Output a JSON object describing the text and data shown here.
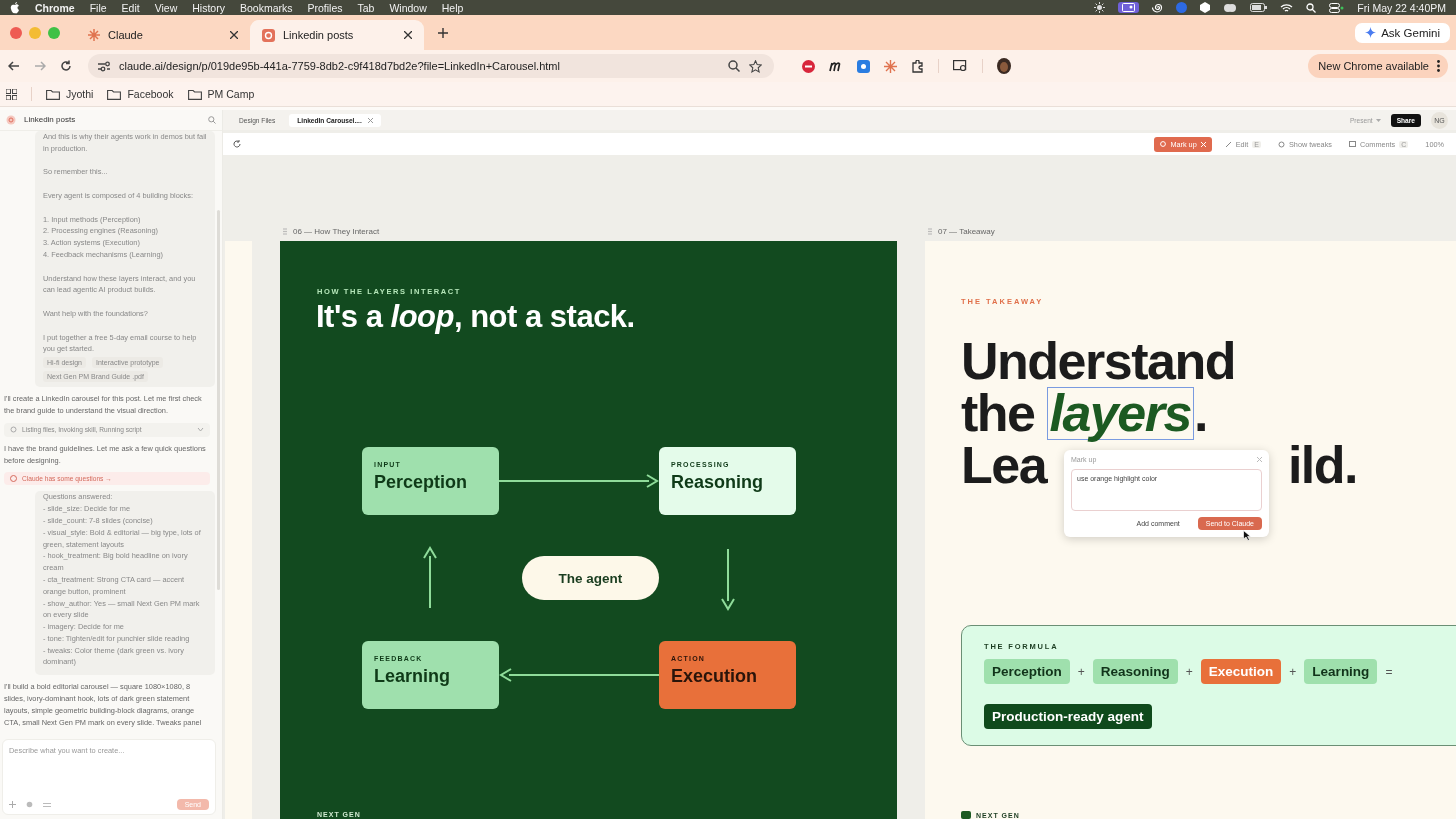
{
  "menubar": {
    "app": "Chrome",
    "menus": [
      "File",
      "Edit",
      "View",
      "History",
      "Bookmarks",
      "Profiles",
      "Tab",
      "Window",
      "Help"
    ],
    "clock": "Fri May 22  4:40PM"
  },
  "tabs": [
    {
      "title": "Claude",
      "selected": false
    },
    {
      "title": "Linkedin posts",
      "selected": true
    }
  ],
  "ask_gemini": "Ask Gemini",
  "address": "claude.ai/design/p/019de95b-441a-7759-8db2-c9f418d7bd2e?file=LinkedIn+Carousel.html",
  "update_button": "New Chrome available",
  "bookmarks": [
    "Jyothi",
    "Facebook",
    "PM Camp"
  ],
  "sidebar": {
    "title": "Linkedin posts",
    "messages": [
      {
        "kind": "user",
        "paragraphs": [
          "And this is why their agents work in demos but fail in production.",
          "So remember this...",
          "Every agent is composed of 4 building blocks:",
          "1. Input methods (Perception)\n2. Processing engines (Reasoning)\n3. Action systems (Execution)\n4. Feedback mechanisms (Learning)",
          "Understand how these layers interact, and you can lead agentic AI product builds.",
          "Want help with the foundations?",
          "I put together a free 5-day email course to help you get started."
        ],
        "attachments": [
          "Hi-fi design",
          "Interactive prototype",
          "Next Gen PM Brand Guide .pdf"
        ]
      },
      {
        "kind": "assistant",
        "text": "I'll create a LinkedIn carousel for this post. Let me first check the brand guide to understand the visual direction."
      },
      {
        "kind": "tool",
        "text": "Listing files, Invoking skill, Running script"
      },
      {
        "kind": "assistant",
        "text": "I have the brand guidelines. Let me ask a few quick questions before designing."
      },
      {
        "kind": "notice",
        "text": "Claude has some questions →"
      },
      {
        "kind": "user",
        "paragraphs": [
          "Questions answered:\n- slide_size: Decide for me\n- slide_count: 7-8 slides (concise)\n- visual_style: Bold & editorial — big type, lots of green, statement layouts\n- hook_treatment: Big bold headline on ivory cream\n- cta_treatment: Strong CTA card — accent orange button, prominent\n- show_author: Yes — small Next Gen PM mark on every slide\n- imagery: Decide for me\n- tone: Tighten/edit for punchier slide reading\n- tweaks: Color theme (dark green vs. ivory dominant)"
        ]
      },
      {
        "kind": "assistant",
        "text": "I'll build a bold editorial carousel — square 1080×1080, 8 slides, ivory-dominant hook, lots of dark green statement layouts, simple geometric building-block diagrams, orange CTA, small Next Gen PM mark on every slide. Tweaks panel"
      }
    ],
    "composer": {
      "placeholder": "Describe what you want to create...",
      "send": "Send"
    }
  },
  "design_tabs": [
    {
      "title": "Design Files",
      "selected": false
    },
    {
      "title": "LinkedIn Carousel....",
      "selected": true
    }
  ],
  "header_actions": {
    "present": "Present",
    "share": "Share",
    "avatar": "NG"
  },
  "toolbar": [
    {
      "kind": "markup",
      "label": "Mark up",
      "selected": true
    },
    {
      "kind": "tool",
      "label": "Edit",
      "shortcut": "E",
      "selected": false
    },
    {
      "kind": "tool",
      "label": "Show tweaks",
      "selected": false
    },
    {
      "kind": "tool",
      "label": "Comments",
      "shortcut": "C",
      "selected": false
    },
    {
      "kind": "zoom",
      "label": "100%",
      "selected": false
    }
  ],
  "slides": [
    {
      "kind": "diagram",
      "label": "06 — How They Interact",
      "eyebrow": "HOW THE LAYERS INTERACT",
      "title": "It's a *loop*, not a stack.",
      "nodes": [
        {
          "eyebrow": "INPUT",
          "label": "Perception",
          "kind": "light"
        },
        {
          "eyebrow": "PROCESSING",
          "label": "Reasoning",
          "kind": "pale"
        },
        {
          "eyebrow": "FEEDBACK",
          "label": "Learning",
          "kind": "light"
        },
        {
          "eyebrow": "ACTION",
          "label": "Execution",
          "kind": "accent"
        }
      ],
      "center": "The agent",
      "footer": "NEXT GEN"
    },
    {
      "kind": "takeaway",
      "label": "07 — Takeaway",
      "eyebrow": "THE TAKEAWAY",
      "headline": {
        "line1": "Understand",
        "line2": "the",
        "highlight": "layers",
        "line2_end": ".",
        "line3_start": "Lea",
        "line3_end": "ild."
      },
      "formula_title": "THE FORMULA",
      "formula": [
        {
          "kind": "term",
          "text": "Perception"
        },
        {
          "kind": "op",
          "text": "+"
        },
        {
          "kind": "term",
          "text": "Reasoning"
        },
        {
          "kind": "op",
          "text": "+"
        },
        {
          "kind": "accent",
          "text": "Execution"
        },
        {
          "kind": "op",
          "text": "+"
        },
        {
          "kind": "term",
          "text": "Learning"
        },
        {
          "kind": "op",
          "text": "="
        },
        {
          "kind": "result",
          "text": "Production-ready agent"
        }
      ],
      "footer": "NEXT GEN"
    }
  ],
  "markup_popup": {
    "title": "Mark up",
    "value": "use orange highlight color",
    "buttons": [
      "Add comment",
      "Send to Claude"
    ]
  }
}
